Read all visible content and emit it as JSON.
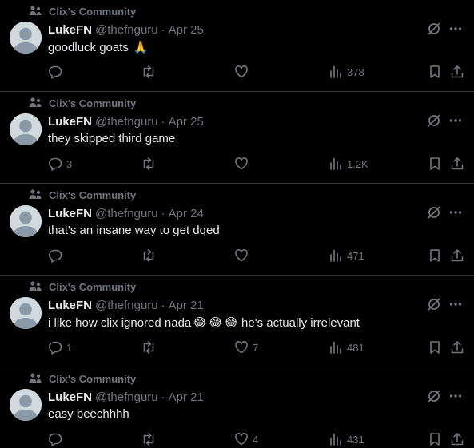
{
  "colors": {
    "background": "#000000",
    "divider": "#2f3336",
    "primary_text": "#e7e9ea",
    "secondary_text": "#71767b",
    "avatar_bg": "#cfd9de"
  },
  "icons": {
    "community": "community-icon",
    "avatar": "default-avatar-icon",
    "grok": "grok-icon",
    "more": "more-icon",
    "reply": "reply-icon",
    "repost": "repost-icon",
    "like": "heart-icon",
    "views": "views-icon",
    "bookmark": "bookmark-icon",
    "share": "share-icon"
  },
  "posts": [
    {
      "community": "Clix's Community",
      "display_name": "LukeFN",
      "handle": "@thefnguru",
      "separator": "·",
      "date": "Apr 25",
      "text": "goodluck goats",
      "emojis": [
        "🙏"
      ],
      "after_emoji_text": "",
      "reply_count": "",
      "repost_count": "",
      "like_count": "",
      "view_count": "378"
    },
    {
      "community": "Clix's Community",
      "display_name": "LukeFN",
      "handle": "@thefnguru",
      "separator": "·",
      "date": "Apr 25",
      "text": "they skipped third game",
      "emojis": [],
      "after_emoji_text": "",
      "reply_count": "3",
      "repost_count": "",
      "like_count": "",
      "view_count": "1.2K"
    },
    {
      "community": "Clix's Community",
      "display_name": "LukeFN",
      "handle": "@thefnguru",
      "separator": "·",
      "date": "Apr 24",
      "text": "that's an insane way to get dqed",
      "emojis": [],
      "after_emoji_text": "",
      "reply_count": "",
      "repost_count": "",
      "like_count": "",
      "view_count": "471"
    },
    {
      "community": "Clix's Community",
      "display_name": "LukeFN",
      "handle": "@thefnguru",
      "separator": "·",
      "date": "Apr 21",
      "text": "i like how clix ignored nada",
      "emojis": [
        "😂",
        "😂",
        "😂"
      ],
      "after_emoji_text": " he's actually irrelevant",
      "reply_count": "1",
      "repost_count": "",
      "like_count": "7",
      "view_count": "481"
    },
    {
      "community": "Clix's Community",
      "display_name": "LukeFN",
      "handle": "@thefnguru",
      "separator": "·",
      "date": "Apr 21",
      "text": "easy beechhhh",
      "emojis": [],
      "after_emoji_text": "",
      "reply_count": "",
      "repost_count": "",
      "like_count": "4",
      "view_count": "431"
    }
  ]
}
